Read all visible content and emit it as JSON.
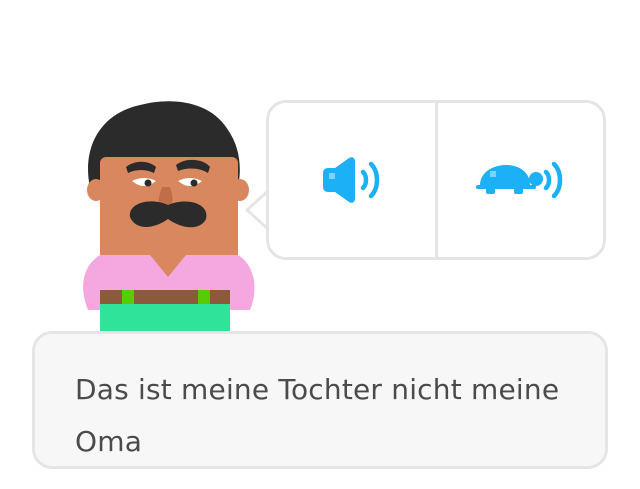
{
  "exercise": {
    "audio": {
      "normal_icon": "speaker-icon",
      "slow_icon": "turtle-speaker-icon",
      "accent_color": "#1cb0f6"
    },
    "character": {
      "icon": "man-with-mustache-character"
    },
    "answer": {
      "text": "Das ist meine Tochter nicht meine Oma"
    }
  }
}
